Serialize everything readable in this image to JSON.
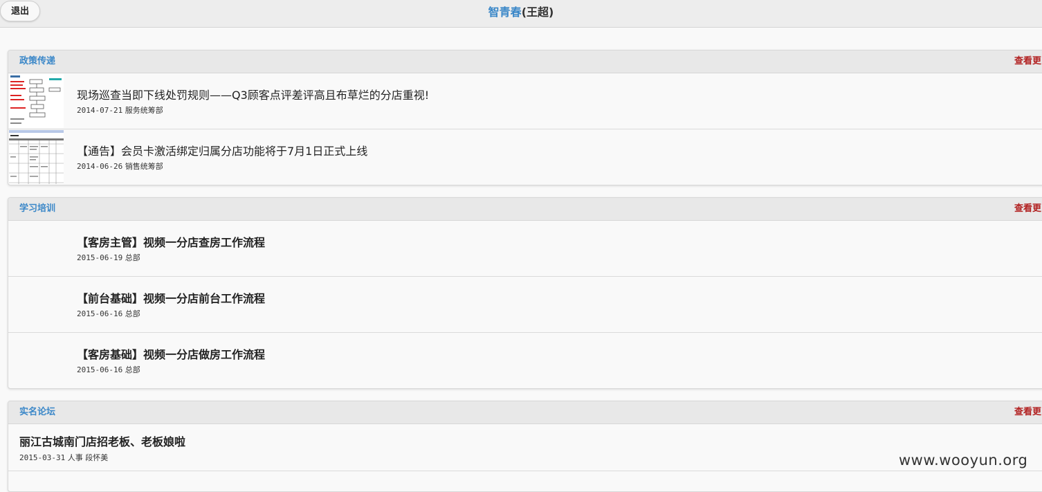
{
  "header": {
    "logout_label": "退出",
    "org_name": "智青春",
    "user_name": "(王超)"
  },
  "sections": [
    {
      "title": "政策传递",
      "more_label": "查看更",
      "items": [
        {
          "title": "现场巡查当即下线处罚规则——Q3顾客点评差评高且布草烂的分店重视!",
          "date": "2014-07-21",
          "dept": "服务统筹部"
        },
        {
          "title": "【通告】会员卡激活绑定归属分店功能将于7月1日正式上线",
          "date": "2014-06-26",
          "dept": "销售统筹部"
        }
      ]
    },
    {
      "title": "学习培训",
      "more_label": "查看更",
      "items": [
        {
          "title": "【客房主管】视频一分店查房工作流程",
          "date": "2015-06-19",
          "dept": "总部"
        },
        {
          "title": "【前台基础】视频一分店前台工作流程",
          "date": "2015-06-16",
          "dept": "总部"
        },
        {
          "title": "【客房基础】视频一分店做房工作流程",
          "date": "2015-06-16",
          "dept": "总部"
        }
      ]
    },
    {
      "title": "实名论坛",
      "more_label": "查看更",
      "items": [
        {
          "title": "丽江古城南门店招老板、老板娘啦",
          "date": "2015-03-31",
          "dept": "人事",
          "author": "段怀美"
        }
      ]
    }
  ],
  "watermark": "www.wooyun.org"
}
